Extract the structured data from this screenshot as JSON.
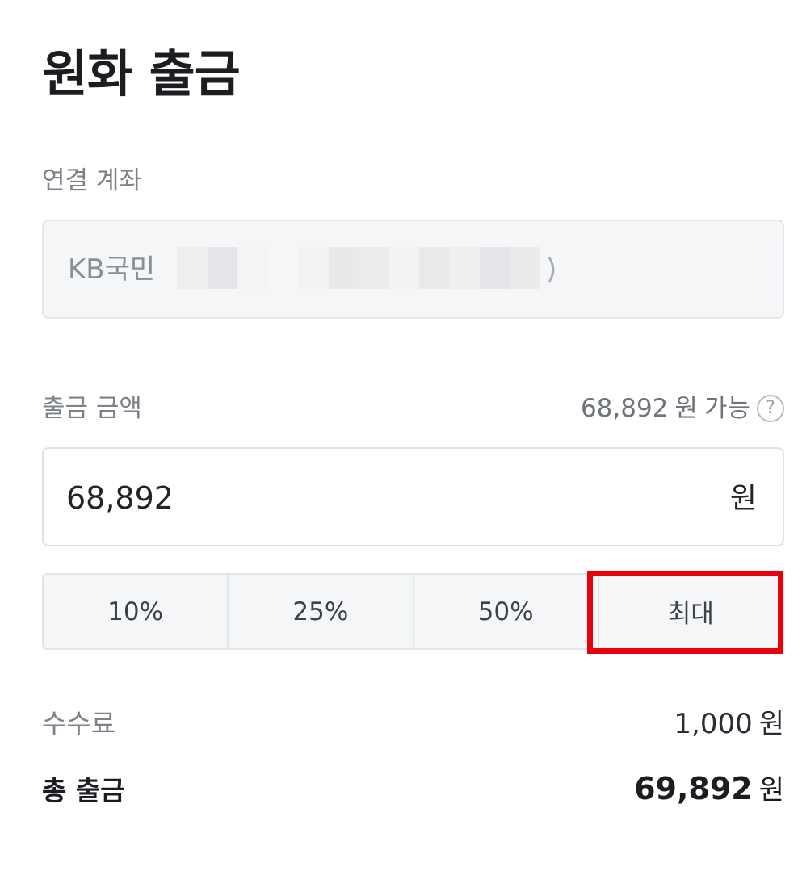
{
  "page": {
    "title": "원화 출금"
  },
  "account": {
    "label": "연결 계좌",
    "bank_prefix": "KB국민",
    "masked_suffix": ")"
  },
  "amount": {
    "label": "출금 금액",
    "available_value": "68,892",
    "available_unit": "원",
    "available_suffix": "가능",
    "help_icon_glyph": "?",
    "input_value": "68,892",
    "unit": "원"
  },
  "percent_buttons": [
    {
      "label": "10%"
    },
    {
      "label": "25%"
    },
    {
      "label": "50%"
    },
    {
      "label": "최대"
    }
  ],
  "summary": {
    "fee_label": "수수료",
    "fee_value": "1,000",
    "fee_unit": "원",
    "total_label": "총 출금",
    "total_value": "69,892",
    "total_unit": "원"
  },
  "colors": {
    "highlight_border": "#e8000b",
    "field_background": "#f5f6f7",
    "muted_text": "#7d828a"
  },
  "icons": {
    "help": "question-circle-icon"
  }
}
